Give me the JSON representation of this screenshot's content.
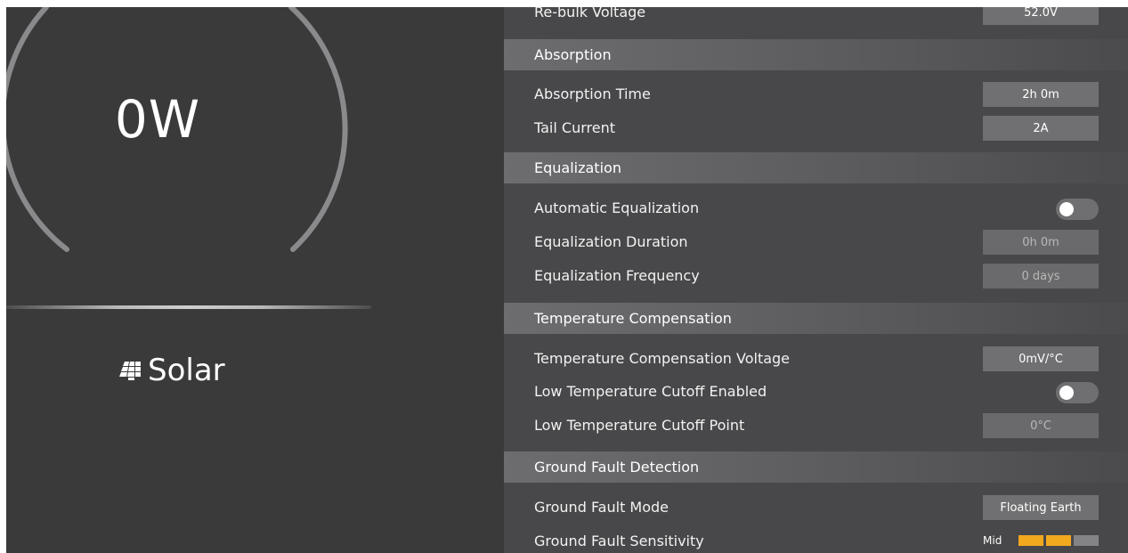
{
  "gauge": {
    "power": "0W"
  },
  "source": {
    "label": "Solar",
    "icon": "solar-panel-icon"
  },
  "rows": {
    "rebulk": {
      "label": "Re-bulk Voltage",
      "value": "52.0V"
    },
    "absorption_time": {
      "label": "Absorption Time",
      "value": "2h 0m"
    },
    "tail_current": {
      "label": "Tail Current",
      "value": "2A"
    },
    "auto_eq": {
      "label": "Automatic Equalization",
      "enabled": false
    },
    "eq_duration": {
      "label": "Equalization Duration",
      "value": "0h 0m"
    },
    "eq_frequency": {
      "label": "Equalization Frequency",
      "value": "0 days"
    },
    "temp_comp_voltage": {
      "label": "Temperature Compensation Voltage",
      "value": "0mV/°C"
    },
    "low_temp_enabled": {
      "label": "Low Temperature Cutoff  Enabled",
      "enabled": false
    },
    "low_temp_point": {
      "label": "Low Temperature Cutoff Point",
      "value": "0°C"
    },
    "gf_mode": {
      "label": "Ground Fault Mode",
      "value": "Floating Earth"
    },
    "gf_sensitivity": {
      "label": "Ground Fault Sensitivity",
      "value": "Mid",
      "level": 2,
      "max_level": 3
    }
  },
  "sections": {
    "absorption": "Absorption",
    "equalization": "Equalization",
    "temp_comp": "Temperature Compensation",
    "ground_fault": "Ground Fault Detection"
  },
  "colors": {
    "accent": "#f3a91e",
    "panel_left": "#3a3a3b",
    "panel_right": "#48484a"
  }
}
